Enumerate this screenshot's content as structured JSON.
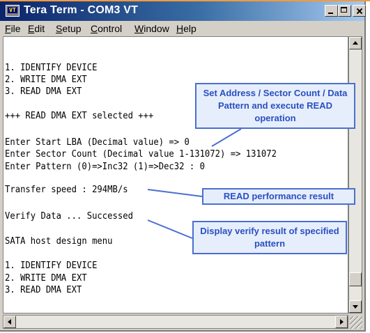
{
  "window": {
    "title": "Tera Term - COM3 VT",
    "app_icon_text": "VT",
    "buttons": [
      "minimize-icon",
      "maximize-icon",
      "close-icon"
    ]
  },
  "menu": {
    "items": [
      "File",
      "Edit",
      "Setup",
      "Control",
      "Window",
      "Help"
    ]
  },
  "terminal": {
    "lines": [
      "",
      "1. IDENTIFY DEVICE",
      "2. WRITE DMA EXT",
      "3. READ DMA EXT",
      "",
      "+++ READ DMA EXT selected +++",
      "",
      "Enter Start LBA (Decimal value) => 0",
      "Enter Sector Count (Decimal value 1-131072) => 131072",
      "Enter Pattern (0)=>Inc32 (1)=>Dec32 : 0",
      "",
      "Transfer speed : 294MB/s",
      "",
      "Verify Data ... Successed",
      "",
      "SATA host design menu",
      "",
      "1. IDENTIFY DEVICE",
      "2. WRITE DMA EXT",
      "3. READ DMA EXT"
    ]
  },
  "annotations": {
    "read_op": "Set Address / Sector Count / Data Pattern and execute READ operation",
    "perf": "READ performance result",
    "verify": "Display verify result of specified pattern"
  },
  "colors": {
    "title_bar": "#0a246a",
    "callout_border": "#4b6fd0",
    "callout_text": "#2a4fc3",
    "callout_fill": "#e6eefb",
    "accent": "#f29a3d"
  }
}
